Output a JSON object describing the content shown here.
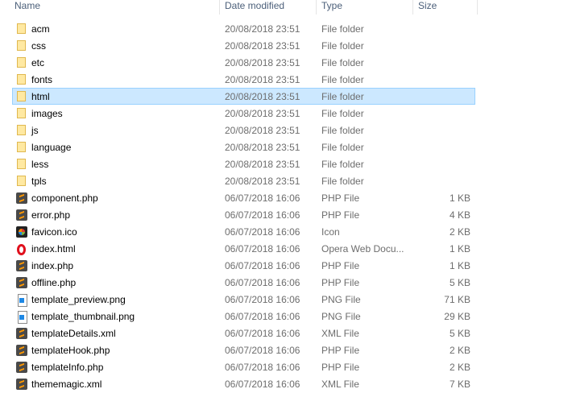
{
  "columns": {
    "name": "Name",
    "date": "Date modified",
    "type": "Type",
    "size": "Size"
  },
  "files": [
    {
      "name": "acm",
      "date": "20/08/2018 23:51",
      "type": "File folder",
      "size": "",
      "icon": "folder-icon"
    },
    {
      "name": "css",
      "date": "20/08/2018 23:51",
      "type": "File folder",
      "size": "",
      "icon": "folder-icon"
    },
    {
      "name": "etc",
      "date": "20/08/2018 23:51",
      "type": "File folder",
      "size": "",
      "icon": "folder-icon"
    },
    {
      "name": "fonts",
      "date": "20/08/2018 23:51",
      "type": "File folder",
      "size": "",
      "icon": "folder-icon"
    },
    {
      "name": "html",
      "date": "20/08/2018 23:51",
      "type": "File folder",
      "size": "",
      "icon": "folder-icon",
      "selected": true
    },
    {
      "name": "images",
      "date": "20/08/2018 23:51",
      "type": "File folder",
      "size": "",
      "icon": "folder-icon"
    },
    {
      "name": "js",
      "date": "20/08/2018 23:51",
      "type": "File folder",
      "size": "",
      "icon": "folder-icon"
    },
    {
      "name": "language",
      "date": "20/08/2018 23:51",
      "type": "File folder",
      "size": "",
      "icon": "folder-icon"
    },
    {
      "name": "less",
      "date": "20/08/2018 23:51",
      "type": "File folder",
      "size": "",
      "icon": "folder-icon"
    },
    {
      "name": "tpls",
      "date": "20/08/2018 23:51",
      "type": "File folder",
      "size": "",
      "icon": "folder-icon"
    },
    {
      "name": "component.php",
      "date": "06/07/2018 16:06",
      "type": "PHP File",
      "size": "1 KB",
      "icon": "sublime-icon"
    },
    {
      "name": "error.php",
      "date": "06/07/2018 16:06",
      "type": "PHP File",
      "size": "4 KB",
      "icon": "sublime-icon"
    },
    {
      "name": "favicon.ico",
      "date": "06/07/2018 16:06",
      "type": "Icon",
      "size": "2 KB",
      "icon": "joomla-icon"
    },
    {
      "name": "index.html",
      "date": "06/07/2018 16:06",
      "type": "Opera Web Docu...",
      "size": "1 KB",
      "icon": "opera-icon"
    },
    {
      "name": "index.php",
      "date": "06/07/2018 16:06",
      "type": "PHP File",
      "size": "1 KB",
      "icon": "sublime-icon"
    },
    {
      "name": "offline.php",
      "date": "06/07/2018 16:06",
      "type": "PHP File",
      "size": "5 KB",
      "icon": "sublime-icon"
    },
    {
      "name": "template_preview.png",
      "date": "06/07/2018 16:06",
      "type": "PNG File",
      "size": "71 KB",
      "icon": "image-file-icon"
    },
    {
      "name": "template_thumbnail.png",
      "date": "06/07/2018 16:06",
      "type": "PNG File",
      "size": "29 KB",
      "icon": "image-file-icon"
    },
    {
      "name": "templateDetails.xml",
      "date": "06/07/2018 16:06",
      "type": "XML File",
      "size": "5 KB",
      "icon": "sublime-icon"
    },
    {
      "name": "templateHook.php",
      "date": "06/07/2018 16:06",
      "type": "PHP File",
      "size": "2 KB",
      "icon": "sublime-icon"
    },
    {
      "name": "templateInfo.php",
      "date": "06/07/2018 16:06",
      "type": "PHP File",
      "size": "2 KB",
      "icon": "sublime-icon"
    },
    {
      "name": "thememagic.xml",
      "date": "06/07/2018 16:06",
      "type": "XML File",
      "size": "7 KB",
      "icon": "sublime-icon"
    }
  ]
}
